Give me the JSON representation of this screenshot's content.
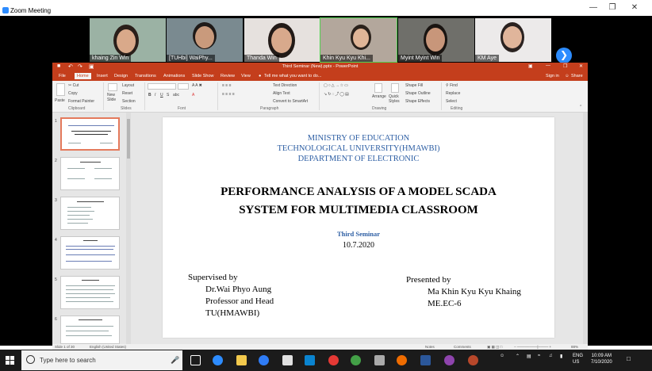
{
  "window": {
    "title": "Zoom Meeting"
  },
  "participants": [
    {
      "name": "khaing Zin Win"
    },
    {
      "name": "[TUHbi] WaiPhy..."
    },
    {
      "name": "Thanda Win"
    },
    {
      "name": "Khin Kyu Kyu Khi..."
    },
    {
      "name": "Myint Myint Win"
    },
    {
      "name": "KM Aye"
    }
  ],
  "ppt": {
    "title": "Third Seminar (New).pptx - PowerPoint",
    "signin": "Sign in",
    "share": "Share",
    "tabs": [
      "File",
      "Home",
      "Insert",
      "Design",
      "Transitions",
      "Animations",
      "Slide Show",
      "Review",
      "View"
    ],
    "tellme": "Tell me what you want to do...",
    "groups": {
      "clipboard": "Clipboard",
      "slides": "Slides",
      "font": "Font",
      "paragraph": "Paragraph",
      "drawing": "Drawing",
      "editing": "Editing"
    },
    "ribbon": {
      "paste": "Paste",
      "cut": "Cut",
      "copy": "Copy",
      "format_painter": "Format Painter",
      "new_slide": "New Slide",
      "layout": "Layout",
      "reset": "Reset",
      "section": "Section",
      "text_direction": "Text Direction",
      "align_text": "Align Text",
      "smartart": "Convert to SmartArt",
      "arrange": "Arrange",
      "quick_styles": "Quick Styles",
      "shape_fill": "Shape Fill",
      "shape_outline": "Shape Outline",
      "shape_effects": "Shape Effects",
      "find": "Find",
      "replace": "Replace",
      "select": "Select"
    },
    "slide_numbers": [
      "1",
      "2",
      "3",
      "4",
      "5",
      "6"
    ],
    "thumb_titles": [
      "PERFORMANCE ANALYSIS OF A MODEL SCADA",
      "Board of Examiners",
      "Outline of Presentation",
      "Abstract",
      "Introduction",
      "Aim and Objectives"
    ],
    "status": {
      "slide": "Slide 1 of 30",
      "lang": "English (United States)",
      "notes": "Notes",
      "comments": "Comments",
      "zoom": "88%"
    }
  },
  "slide": {
    "ministry": "MINISTRY OF EDUCATION",
    "university": "TECHNOLOGICAL UNIVERSITY(HMAWBI)",
    "department": "DEPARTMENT OF ELECTRONIC",
    "title_line1": "PERFORMANCE ANALYSIS OF A MODEL SCADA",
    "title_line2": "SYSTEM FOR MULTIMEDIA CLASSROOM",
    "seminar": "Third Seminar",
    "date": "10.7.2020",
    "supervised_label": "Supervised by",
    "supervisor_name": "Dr.Wai Phyo Aung",
    "supervisor_role": "Professor and Head",
    "supervisor_org": "TU(HMAWBI)",
    "presented_label": "Presented by",
    "presenter_name": "Ma Khin Kyu Kyu Khaing",
    "presenter_class": "ME.EC-6"
  },
  "taskbar": {
    "search_placeholder": "Type here to search",
    "lang": "ENG",
    "region": "US",
    "time": "10:09 AM",
    "date": "7/10/2020",
    "colors": [
      "#ffffff",
      "#ffffff",
      "#2d8cff",
      "#f2c94c",
      "#2f7cf6",
      "#0a84d0",
      "#e1e1e1",
      "#1e88e5",
      "#e53935",
      "#43a047",
      "#2e7d32",
      "#ef6c00",
      "#2b579a",
      "#b7472a",
      "#e8a317"
    ]
  }
}
